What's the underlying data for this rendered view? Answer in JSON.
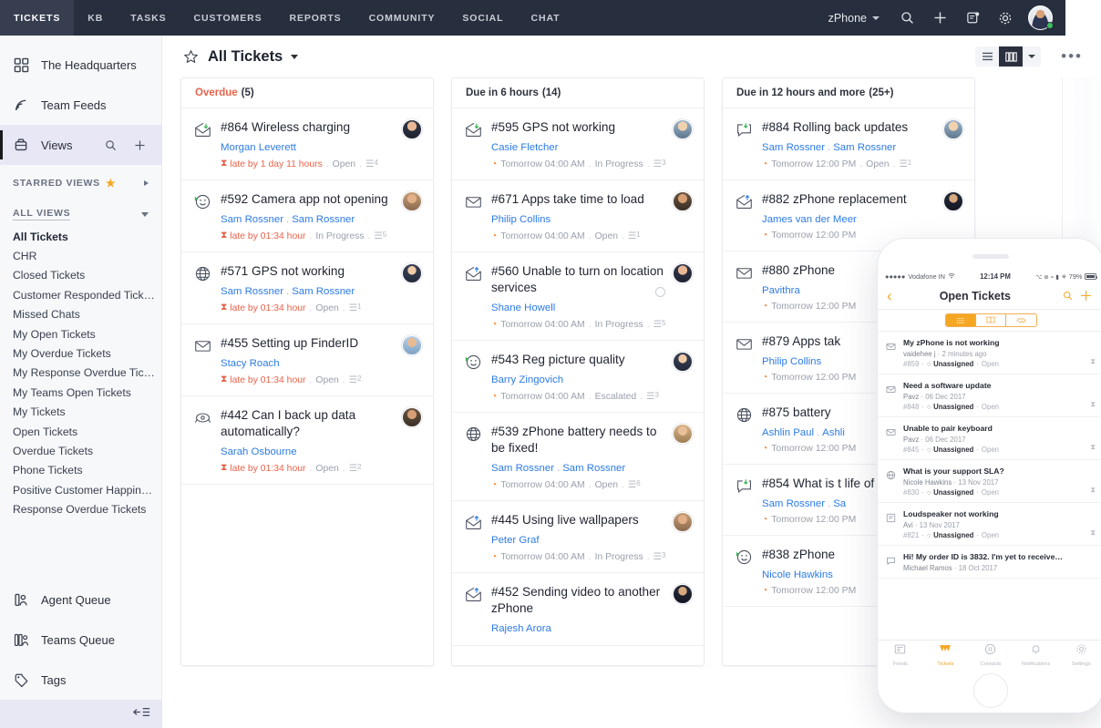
{
  "topnav": {
    "tabs": [
      {
        "label": "TICKETS",
        "active": true
      },
      {
        "label": "KB",
        "active": false
      },
      {
        "label": "TASKS",
        "active": false
      },
      {
        "label": "CUSTOMERS",
        "active": false
      },
      {
        "label": "REPORTS",
        "active": false
      },
      {
        "label": "COMMUNITY",
        "active": false
      },
      {
        "label": "SOCIAL",
        "active": false
      },
      {
        "label": "CHAT",
        "active": false
      }
    ],
    "product_selector": "zPhone",
    "icons": [
      "search-icon",
      "plus-icon",
      "notes-icon",
      "gear-icon"
    ],
    "avatar_status": "online",
    "bg_color": "#272e3d",
    "active_tab_color": "#363e4f"
  },
  "sidebar": {
    "top_items": [
      {
        "label": "The Headquarters",
        "icon": "grid-icon"
      },
      {
        "label": "Team Feeds",
        "icon": "feed-icon"
      },
      {
        "label": "Views",
        "icon": "views-icon",
        "selected": true,
        "actions": [
          "search-icon",
          "plus-icon"
        ]
      }
    ],
    "starred_section": {
      "label": "STARRED VIEWS",
      "icon": "star-icon",
      "expanded": false
    },
    "all_views_section": {
      "label": "ALL VIEWS",
      "expanded": true
    },
    "views": [
      {
        "label": "All Tickets",
        "selected": true
      },
      {
        "label": "CHR",
        "selected": false
      },
      {
        "label": "Closed Tickets",
        "selected": false
      },
      {
        "label": "Customer Responded Tick…",
        "selected": false
      },
      {
        "label": "Missed Chats",
        "selected": false
      },
      {
        "label": "My Open Tickets",
        "selected": false
      },
      {
        "label": "My Overdue Tickets",
        "selected": false
      },
      {
        "label": "My Response Overdue Tic…",
        "selected": false
      },
      {
        "label": "My Teams Open Tickets",
        "selected": false
      },
      {
        "label": "My Tickets",
        "selected": false
      },
      {
        "label": "Open Tickets",
        "selected": false
      },
      {
        "label": "Overdue Tickets",
        "selected": false
      },
      {
        "label": "Phone Tickets",
        "selected": false
      },
      {
        "label": "Positive Customer Happin…",
        "selected": false
      },
      {
        "label": "Response Overdue Tickets",
        "selected": false
      }
    ],
    "bottom_items": [
      {
        "label": "Agent Queue",
        "icon": "agent-queue-icon"
      },
      {
        "label": "Teams Queue",
        "icon": "teams-queue-icon"
      },
      {
        "label": "Tags",
        "icon": "tag-icon"
      }
    ],
    "collapse_label": "collapse-sidebar-icon"
  },
  "main": {
    "view_title": "All Tickets",
    "star_icon": "star-outline-icon",
    "toolbar": {
      "list_view_icon": "list-view-icon",
      "board_view_icon": "board-view-icon",
      "board_view_active": true,
      "more_icon": "more-options-icon"
    }
  },
  "board": {
    "columns": [
      {
        "title": "Overdue",
        "count": "(5)",
        "title_color": "#e8634a",
        "cards": [
          {
            "id": "#864",
            "subject": "Wireless charging",
            "channel": "email-reply-icon",
            "people": [
              "Morgan Leverett"
            ],
            "due": "late by 1 day 11 hours",
            "due_type": "late",
            "status": "Open",
            "threads": "4",
            "avatar": "av1"
          },
          {
            "id": "#592",
            "subject": "Camera app not opening",
            "channel": "feedback-icon",
            "people": [
              "Sam Rossner",
              "Sam Rossner"
            ],
            "due": "late by 01:34 hour",
            "due_type": "late",
            "status": "In Progress",
            "threads": "5",
            "avatar": "av2"
          },
          {
            "id": "#571",
            "subject": "GPS not working",
            "channel": "portal-icon",
            "people": [
              "Sam Rossner",
              "Sam Rossner"
            ],
            "due": "late by 01:34 hour",
            "due_type": "late",
            "status": "Open",
            "threads": "1",
            "avatar": "av3"
          },
          {
            "id": "#455",
            "subject": "Setting up FinderID",
            "channel": "email-icon",
            "people": [
              "Stacy Roach"
            ],
            "due": "late by 01:34 hour",
            "due_type": "late",
            "status": "Open",
            "threads": "2",
            "avatar": "av4"
          },
          {
            "id": "#442",
            "subject": "Can I back up data automatically?",
            "channel": "phone-icon",
            "people": [
              "Sarah Osbourne"
            ],
            "due": "late by 01:34 hour",
            "due_type": "late",
            "status": "Open",
            "threads": "2",
            "avatar": "av5"
          }
        ]
      },
      {
        "title": "Due in 6 hours",
        "count": "(14)",
        "title_color": "#2d323d",
        "cards": [
          {
            "id": "#595",
            "subject": "GPS not working",
            "channel": "email-reply-icon",
            "people": [
              "Casie Fletcher"
            ],
            "due": "Tomorrow 04:00 AM",
            "due_type": "clock",
            "status": "In Progress",
            "threads": "3",
            "avatar": "av6"
          },
          {
            "id": "#671",
            "subject": "Apps take time to load",
            "channel": "email-icon",
            "people": [
              "Philip Collins"
            ],
            "due": "Tomorrow 04:00 AM",
            "due_type": "clock",
            "status": "Open",
            "threads": "1",
            "avatar": "av5"
          },
          {
            "id": "#560",
            "subject": "Unable to turn on location services",
            "channel": "email-forward-icon",
            "people": [
              "Shane Howell"
            ],
            "due": "Tomorrow 04:00 AM",
            "due_type": "clock",
            "status": "In Progress",
            "threads": "5",
            "avatar": "av1",
            "has_circle": true
          },
          {
            "id": "#543",
            "subject": "Reg picture quality",
            "channel": "feedback-icon",
            "people": [
              "Barry Zingovich"
            ],
            "due": "Tomorrow 04:00 AM",
            "due_type": "clock",
            "status": "Escalated",
            "threads": "3",
            "avatar": "av3"
          },
          {
            "id": "#539",
            "subject": "zPhone battery needs to be fixed!",
            "channel": "portal-icon",
            "people": [
              "Sam Rossner",
              "Sam Rossner"
            ],
            "due": "Tomorrow 04:00 AM",
            "due_type": "clock",
            "status": "Open",
            "threads": "6",
            "avatar": "av7"
          },
          {
            "id": "#445",
            "subject": "Using live wallpapers",
            "channel": "email-forward-icon",
            "people": [
              "Peter Graf"
            ],
            "due": "Tomorrow 04:00 AM",
            "due_type": "clock",
            "status": "In Progress",
            "threads": "3",
            "avatar": "av2"
          },
          {
            "id": "#452",
            "subject": "Sending video to another zPhone",
            "channel": "email-forward-icon",
            "people": [
              "Rajesh Arora"
            ],
            "due": "",
            "due_type": "",
            "status": "",
            "threads": "",
            "avatar": "av8"
          }
        ]
      },
      {
        "title": "Due in 12 hours and more",
        "count": "(25+)",
        "title_color": "#2d323d",
        "cards": [
          {
            "id": "#884",
            "subject": "Rolling back updates",
            "channel": "chat-reply-icon",
            "people": [
              "Sam Rossner",
              "Sam Rossner"
            ],
            "due": "Tomorrow 12:00 PM",
            "due_type": "clock",
            "status": "Open",
            "threads": "1",
            "avatar": "av6"
          },
          {
            "id": "#882",
            "subject": "zPhone replacement",
            "channel": "email-forward-icon",
            "people": [
              "James van der Meer"
            ],
            "due": "Tomorrow 12:00 PM",
            "due_type": "clock",
            "status": "",
            "threads": "",
            "avatar": "av8"
          },
          {
            "id": "#880",
            "subject": "zPhone",
            "channel": "email-icon",
            "people": [
              "Pavithra"
            ],
            "due": "Tomorrow 12:00 PM",
            "due_type": "clock",
            "status": "",
            "threads": "",
            "avatar": ""
          },
          {
            "id": "#879",
            "subject": "Apps tak",
            "channel": "email-icon",
            "people": [
              "Philip Collins"
            ],
            "due": "Tomorrow 12:00 PM",
            "due_type": "clock",
            "status": "",
            "threads": "",
            "avatar": ""
          },
          {
            "id": "#875",
            "subject": "battery",
            "channel": "portal-icon",
            "people": [
              "Ashlin Paul",
              "Ashli"
            ],
            "due": "Tomorrow 12:00 PM",
            "due_type": "clock",
            "status": "",
            "threads": "",
            "avatar": ""
          },
          {
            "id": "#854",
            "subject": "What is t life of a zPhon",
            "channel": "chat-reply-icon",
            "people": [
              "Sam Rossner",
              "Sa"
            ],
            "due": "Tomorrow 12:00 PM",
            "due_type": "clock",
            "status": "",
            "threads": "",
            "avatar": ""
          },
          {
            "id": "#838",
            "subject": "zPhone",
            "channel": "feedback-icon",
            "people": [
              "Nicole Hawkins"
            ],
            "due": "Tomorrow 12:00 PM",
            "due_type": "clock",
            "status": "",
            "threads": "",
            "avatar": ""
          }
        ]
      }
    ]
  },
  "phone": {
    "status_bar": {
      "carrier": "Vodafone IN",
      "time": "12:14 PM",
      "battery": "79%"
    },
    "nav": {
      "back_icon": "chevron-left-icon",
      "title": "Open Tickets",
      "search_icon": "search-icon",
      "add_icon": "plus-icon"
    },
    "segments": [
      {
        "icon": "list-icon",
        "active": true
      },
      {
        "icon": "flag-icon",
        "active": false
      },
      {
        "icon": "handshake-icon",
        "active": false
      }
    ],
    "tickets": [
      {
        "subject": "My zPhone is not working",
        "requester": "vaidehee j",
        "date": "2 minutes ago",
        "id": "#859",
        "assignee": "Unassigned",
        "status": "Open",
        "channel": "email-icon"
      },
      {
        "subject": "Need a software update",
        "requester": "Pavz",
        "date": "06 Dec 2017",
        "id": "#848",
        "assignee": "Unassigned",
        "status": "Open",
        "channel": "email-icon"
      },
      {
        "subject": "Unable to pair keyboard",
        "requester": "Pavz",
        "date": "06 Dec 2017",
        "id": "#845",
        "assignee": "Unassigned",
        "status": "Open",
        "channel": "email-icon"
      },
      {
        "subject": "What is your support SLA?",
        "requester": "Nicole Hawkins",
        "date": "13 Nov 2017",
        "id": "#830",
        "assignee": "Unassigned",
        "status": "Open",
        "channel": "portal-icon"
      },
      {
        "subject": "Loudspeaker not working",
        "requester": "Avi",
        "date": "13 Nov 2017",
        "id": "#821",
        "assignee": "Unassigned",
        "status": "Open",
        "channel": "feedback-icon"
      },
      {
        "subject": "Hi! My order ID is 3832. I'm yet to receive…",
        "requester": "Michael Ramos",
        "date": "18 Oct 2017",
        "id": "",
        "assignee": "",
        "status": "",
        "channel": "chat-icon"
      }
    ],
    "tabs": [
      {
        "label": "Feeds",
        "icon": "feeds-icon",
        "active": false
      },
      {
        "label": "Tickets",
        "icon": "tickets-icon",
        "active": true
      },
      {
        "label": "Contacts",
        "icon": "contacts-icon",
        "active": false
      },
      {
        "label": "Notifications",
        "icon": "bell-icon",
        "active": false
      },
      {
        "label": "Settings",
        "icon": "gear-icon",
        "active": false
      }
    ],
    "accent_color": "#f5a623"
  }
}
